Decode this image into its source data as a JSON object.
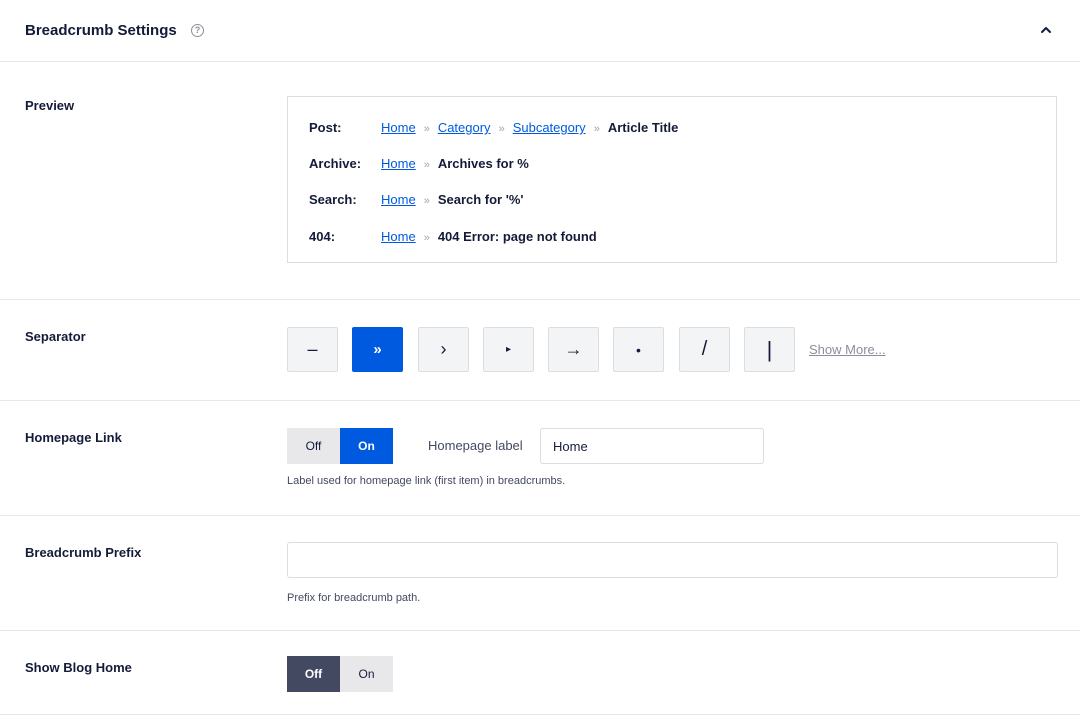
{
  "header": {
    "title": "Breadcrumb Settings",
    "help_glyph": "?",
    "collapse_icon": "chevron-up-icon"
  },
  "preview": {
    "label": "Preview",
    "lines": [
      {
        "key": "Post:",
        "links": [
          "Home",
          "Category",
          "Subcategory"
        ],
        "end": "Article Title"
      },
      {
        "key": "Archive:",
        "links": [
          "Home"
        ],
        "end": "Archives for %"
      },
      {
        "key": "Search:",
        "links": [
          "Home"
        ],
        "end": "Search for '%'"
      },
      {
        "key": "404:",
        "links": [
          "Home"
        ],
        "end": "404 Error: page not found"
      }
    ],
    "separator_glyph": "»"
  },
  "separator": {
    "label": "Separator",
    "options": [
      "–",
      "»",
      "›",
      "▸",
      "→",
      "•",
      "/",
      "|"
    ],
    "selected_index": 1,
    "show_more": "Show More..."
  },
  "homepage_link": {
    "label": "Homepage Link",
    "off": "Off",
    "on": "On",
    "value": "On",
    "field_label": "Homepage label",
    "field_value": "Home",
    "help": "Label used for homepage link (first item) in breadcrumbs."
  },
  "prefix": {
    "label": "Breadcrumb Prefix",
    "value": "",
    "help": "Prefix for breadcrumb path."
  },
  "blog_home": {
    "label": "Show Blog Home",
    "off": "Off",
    "on": "On",
    "value": "Off"
  },
  "colors": {
    "accent": "#005ae0",
    "dark_toggle": "#434960",
    "text": "#141b38"
  }
}
